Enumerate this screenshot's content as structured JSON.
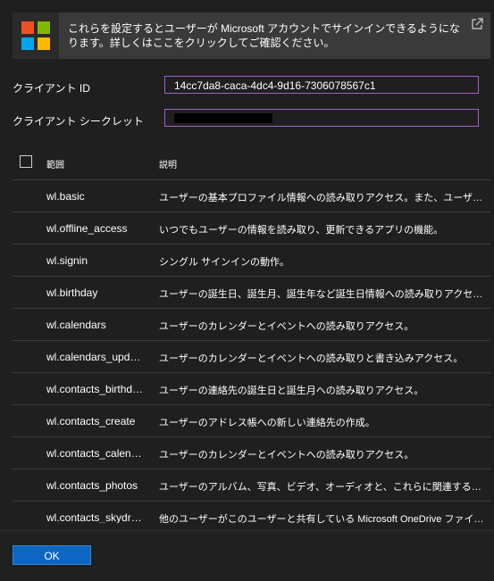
{
  "banner": {
    "text": "これらを設定するとユーザーが Microsoft アカウントでサインインできるようになります。詳しくはここをクリックしてご確認ください。",
    "link_icon": "external-link-icon",
    "logo": "microsoft-logo"
  },
  "client_id": {
    "label": "クライアント ID",
    "value": "14cc7da8-caca-4dc4-9d16-7306078567c1"
  },
  "client_secret": {
    "label": "クライアント シークレット",
    "value_redacted": true
  },
  "table": {
    "headers": {
      "scope": "範囲",
      "description": "説明"
    },
    "rows": [
      {
        "scope": "wl.basic",
        "description": "ユーザーの基本プロファイル情報への読み取りアクセス。また、ユーザーの連絡…"
      },
      {
        "scope": "wl.offline_access",
        "description": "いつでもユーザーの情報を読み取り、更新できるアプリの機能。"
      },
      {
        "scope": "wl.signin",
        "description": "シングル サインインの動作。"
      },
      {
        "scope": "wl.birthday",
        "description": "ユーザーの誕生日、誕生月、誕生年など誕生日情報への読み取りアクセス。"
      },
      {
        "scope": "wl.calendars",
        "description": "ユーザーのカレンダーとイベントへの読み取りアクセス。"
      },
      {
        "scope": "wl.calendars_upd…",
        "description": "ユーザーのカレンダーとイベントへの読み取りと書き込みアクセス。"
      },
      {
        "scope": "wl.contacts_birthd…",
        "description": "ユーザーの連絡先の誕生日と誕生月への読み取りアクセス。"
      },
      {
        "scope": "wl.contacts_create",
        "description": "ユーザーのアドレス帳への新しい連絡先の作成。"
      },
      {
        "scope": "wl.contacts_calen…",
        "description": "ユーザーのカレンダーとイベントへの読み取りアクセス。"
      },
      {
        "scope": "wl.contacts_photos",
        "description": "ユーザーのアルバム、写真、ビデオ、オーディオと、これらに関連するコメントとタグ…"
      },
      {
        "scope": "wl.contacts_skydr…",
        "description": "他のユーザーがこのユーザーと共有している Microsoft OneDrive ファイルへ…"
      }
    ]
  },
  "footer": {
    "ok_label": "OK"
  },
  "colors": {
    "background": "#1f1f1f",
    "banner": "#3a3a3a",
    "input_border": "#a35fc7",
    "ok_button": "#0e65c2"
  }
}
